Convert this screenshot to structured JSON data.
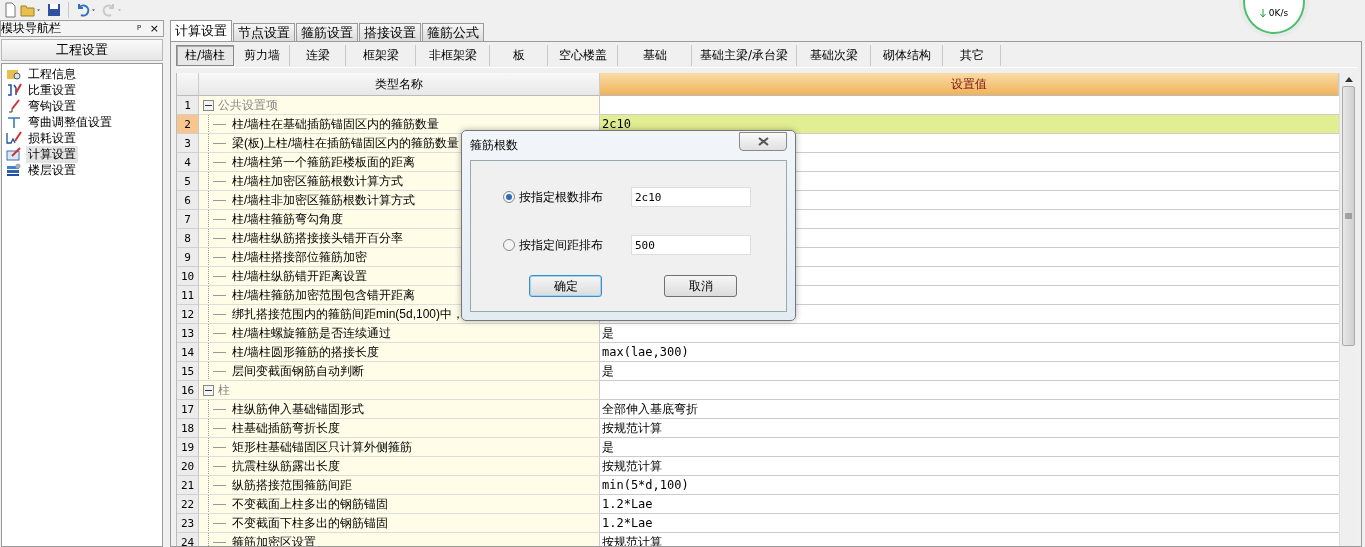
{
  "network_widget": {
    "speed": "0K/s"
  },
  "nav_panel": {
    "title": "模块导航栏",
    "pin": "ᵖ",
    "close": "×",
    "section": "工程设置",
    "items": [
      {
        "label": "工程信息",
        "selected": false
      },
      {
        "label": "比重设置",
        "selected": false
      },
      {
        "label": "弯钩设置",
        "selected": false
      },
      {
        "label": "弯曲调整值设置",
        "selected": false
      },
      {
        "label": "损耗设置",
        "selected": false
      },
      {
        "label": "计算设置",
        "selected": true
      },
      {
        "label": "楼层设置",
        "selected": false
      }
    ]
  },
  "tabs": [
    {
      "label": "计算设置",
      "selected": true
    },
    {
      "label": "节点设置",
      "selected": false
    },
    {
      "label": "箍筋设置",
      "selected": false
    },
    {
      "label": "搭接设置",
      "selected": false
    },
    {
      "label": "箍筋公式",
      "selected": false
    }
  ],
  "subtabs": [
    {
      "label": "柱/墙柱",
      "selected": true
    },
    {
      "label": "剪力墙",
      "selected": false
    },
    {
      "label": "连梁",
      "selected": false
    },
    {
      "label": "框架梁",
      "selected": false
    },
    {
      "label": "非框架梁",
      "selected": false
    },
    {
      "label": "板",
      "selected": false
    },
    {
      "label": "空心楼盖",
      "selected": false
    },
    {
      "label": "基础",
      "selected": false
    },
    {
      "label": "基础主梁/承台梁",
      "selected": false
    },
    {
      "label": "基础次梁",
      "selected": false
    },
    {
      "label": "砌体结构",
      "selected": false
    },
    {
      "label": "其它",
      "selected": false
    }
  ],
  "table": {
    "columns": [
      "类型名称",
      "设置值"
    ],
    "groups": [
      {
        "number": "1",
        "label": "公共设置项",
        "expanded": true,
        "children": [
          {
            "number": "2",
            "name": "柱/墙柱在基础插筋锚固区内的箍筋数量",
            "value": "2c10",
            "selected": true
          },
          {
            "number": "3",
            "name": "梁(板)上柱/墙柱在插筋锚固区内的箍筋数量",
            "selected": false
          },
          {
            "number": "4",
            "name": "柱/墙柱第一个箍筋距楼板面的距离",
            "selected": false
          },
          {
            "number": "5",
            "name": "柱/墙柱加密区箍筋根数计算方式",
            "selected": false
          },
          {
            "number": "6",
            "name": "柱/墙柱非加密区箍筋根数计算方式",
            "selected": false
          },
          {
            "number": "7",
            "name": "柱/墙柱箍筋弯勾角度",
            "selected": false
          },
          {
            "number": "8",
            "name": "柱/墙柱纵筋搭接接头错开百分率",
            "selected": false
          },
          {
            "number": "9",
            "name": "柱/墙柱搭接部位箍筋加密",
            "selected": false
          },
          {
            "number": "10",
            "name": "柱/墙柱纵筋错开距离设置",
            "selected": false
          },
          {
            "number": "11",
            "name": "柱/墙柱箍筋加密范围包含错开距离",
            "selected": false
          },
          {
            "number": "12",
            "name": "绑扎搭接范围内的箍筋间距min(5d,100)中，",
            "selected": false
          },
          {
            "number": "13",
            "name": "柱/墙柱螺旋箍筋是否连续通过",
            "value": "是",
            "selected": false
          },
          {
            "number": "14",
            "name": "柱/墙柱圆形箍筋的搭接长度",
            "value": "max(lae,300)",
            "selected": false
          },
          {
            "number": "15",
            "name": "层间变截面钢筋自动判断",
            "value": "是",
            "selected": false
          }
        ]
      },
      {
        "number": "16",
        "label": "柱",
        "expanded": true,
        "children": [
          {
            "number": "17",
            "name": "柱纵筋伸入基础锚固形式",
            "value": "全部伸入基底弯折",
            "selected": false
          },
          {
            "number": "18",
            "name": "柱基础插筋弯折长度",
            "value": "按规范计算",
            "selected": false
          },
          {
            "number": "19",
            "name": "矩形柱基础锚固区只计算外侧箍筋",
            "value": "是",
            "selected": false
          },
          {
            "number": "20",
            "name": "抗震柱纵筋露出长度",
            "value": "按规范计算",
            "selected": false
          },
          {
            "number": "21",
            "name": "纵筋搭接范围箍筋间距",
            "value": "min(5*d,100)",
            "selected": false
          },
          {
            "number": "22",
            "name": "不变截面上柱多出的钢筋锚固",
            "value": "1.2*Lae",
            "selected": false
          },
          {
            "number": "23",
            "name": "不变截面下柱多出的钢筋锚固",
            "value": "1.2*Lae",
            "selected": false
          },
          {
            "number": "24",
            "name": "箍筋加密区设置",
            "value": "按规范计算",
            "selected": false
          }
        ]
      }
    ]
  },
  "dialog": {
    "title": "箍筋根数",
    "options": [
      {
        "label": "按指定根数排布",
        "value": "2c10",
        "selected": true
      },
      {
        "label": "按指定间距排布",
        "value": "500",
        "selected": false
      }
    ],
    "buttons": [
      {
        "label": "确定",
        "default": true
      },
      {
        "label": "取消",
        "default": false
      }
    ]
  }
}
